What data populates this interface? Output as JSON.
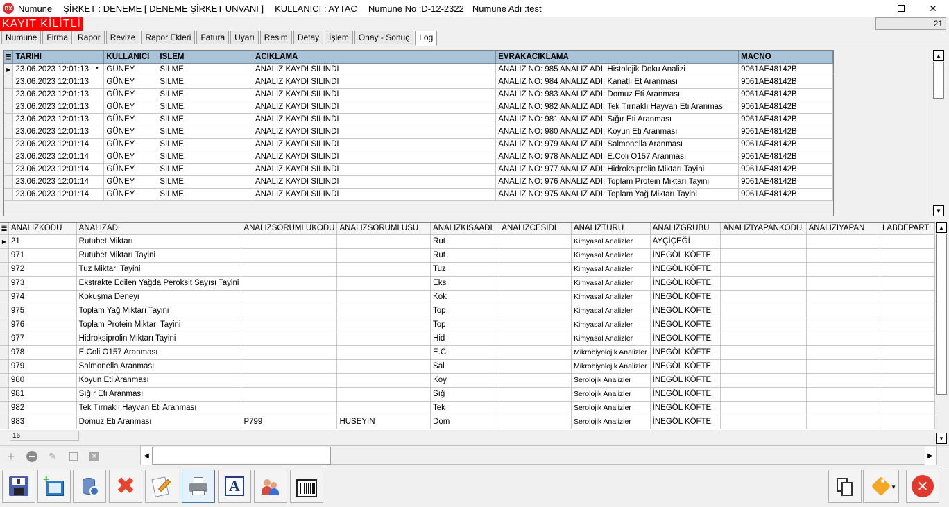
{
  "titlebar": {
    "icon_label": "DX",
    "app_name": "Numune",
    "company": "ŞİRKET : DENEME [ DENEME ŞİRKET UNVANI ]",
    "user": "KULLANICI : AYTAC",
    "sample_no": "Numune No :D-12-2322",
    "sample_name": "Numune Adı :test"
  },
  "lock_banner": "KAYIT KİLİTLİ",
  "record_count": "21",
  "tabs": [
    "Numune",
    "Firma",
    "Rapor",
    "Revize",
    "Rapor Ekleri",
    "Fatura",
    "Uyarı",
    "Resim",
    "Detay",
    "İşlem",
    "Onay - Sonuç",
    "Log"
  ],
  "active_tab": "Log",
  "log_grid": {
    "columns": [
      "TARIHI",
      "KULLANICI",
      "ISLEM",
      "ACIKLAMA",
      "EVRAKACIKLAMA",
      "MACNO"
    ],
    "rows": [
      [
        "23.06.2023 12:01:13",
        "GÜNEY",
        "SILME",
        "ANALIZ KAYDI SILINDI",
        "ANALIZ NO: 985 ANALIZ ADI: Histolojik Doku Analizi",
        "9061AE48142B"
      ],
      [
        "23.06.2023 12:01:13",
        "GÜNEY",
        "SILME",
        "ANALIZ KAYDI SILINDI",
        "ANALIZ NO: 984 ANALIZ ADI: Kanatlı Et  Aranması",
        "9061AE48142B"
      ],
      [
        "23.06.2023 12:01:13",
        "GÜNEY",
        "SILME",
        "ANALIZ KAYDI SILINDI",
        "ANALIZ NO: 983 ANALIZ ADI: Domuz Eti Aranması",
        "9061AE48142B"
      ],
      [
        "23.06.2023 12:01:13",
        "GÜNEY",
        "SILME",
        "ANALIZ KAYDI SILINDI",
        "ANALIZ NO: 982 ANALIZ ADI: Tek Tırnaklı Hayvan Eti Aranması",
        "9061AE48142B"
      ],
      [
        "23.06.2023 12:01:13",
        "GÜNEY",
        "SILME",
        "ANALIZ KAYDI SILINDI",
        "ANALIZ NO: 981 ANALIZ ADI: Sığır Eti Aranması",
        "9061AE48142B"
      ],
      [
        "23.06.2023 12:01:13",
        "GÜNEY",
        "SILME",
        "ANALIZ KAYDI SILINDI",
        "ANALIZ NO: 980 ANALIZ ADI: Koyun Eti Aranması",
        "9061AE48142B"
      ],
      [
        "23.06.2023 12:01:14",
        "GÜNEY",
        "SILME",
        "ANALIZ KAYDI SILINDI",
        "ANALIZ NO: 979 ANALIZ ADI: Salmonella Aranması",
        "9061AE48142B"
      ],
      [
        "23.06.2023 12:01:14",
        "GÜNEY",
        "SILME",
        "ANALIZ KAYDI SILINDI",
        "ANALIZ NO: 978 ANALIZ ADI: E.Coli O157 Aranması",
        "9061AE48142B"
      ],
      [
        "23.06.2023 12:01:14",
        "GÜNEY",
        "SILME",
        "ANALIZ KAYDI SILINDI",
        "ANALIZ NO: 977 ANALIZ ADI: Hidroksiprolin Miktarı Tayini",
        "9061AE48142B"
      ],
      [
        "23.06.2023 12:01:14",
        "GÜNEY",
        "SILME",
        "ANALIZ KAYDI SILINDI",
        "ANALIZ NO: 976 ANALIZ ADI: Toplam Protein Miktarı Tayini",
        "9061AE48142B"
      ],
      [
        "23.06.2023 12:01:14",
        "GÜNEY",
        "SILME",
        "ANALIZ KAYDI SILINDI",
        "ANALIZ NO: 975 ANALIZ ADI: Toplam Yağ Miktarı Tayini",
        "9061AE48142B"
      ]
    ]
  },
  "analysis_grid": {
    "columns": [
      "ANALIZKODU",
      "ANALIZADI",
      "ANALIZSORUMLUKODU",
      "ANALIZSORUMLUSU",
      "ANALIZKISAADI",
      "ANALIZCESIDI",
      "ANALIZTURU",
      "ANALIZGRUBU",
      "ANALIZIYAPANKODU",
      "ANALIZIYAPAN",
      "LABDEPART"
    ],
    "rows": [
      [
        "21",
        "Rutubet Miktarı",
        "",
        "",
        "Rut",
        "",
        "Kimyasal Analizler",
        "AYÇİÇEĞİ",
        "",
        "",
        ""
      ],
      [
        "971",
        "Rutubet Miktarı Tayini",
        "",
        "",
        "Rut",
        "",
        "Kimyasal Analizler",
        "İNEGÖL KÖFTE",
        "",
        "",
        ""
      ],
      [
        "972",
        "Tuz Miktarı Tayini",
        "",
        "",
        "Tuz",
        "",
        "Kimyasal Analizler",
        "İNEGÖL KÖFTE",
        "",
        "",
        ""
      ],
      [
        "973",
        "Ekstrakte Edilen Yağda Peroksit Sayısı Tayini",
        "",
        "",
        "Eks",
        "",
        "Kimyasal Analizler",
        "İNEGÖL KÖFTE",
        "",
        "",
        ""
      ],
      [
        "974",
        "Kokuşma Deneyi",
        "",
        "",
        "Kok",
        "",
        "Kimyasal Analizler",
        "İNEGÖL KÖFTE",
        "",
        "",
        ""
      ],
      [
        "975",
        "Toplam Yağ Miktarı Tayini",
        "",
        "",
        "Top",
        "",
        "Kimyasal Analizler",
        "İNEGÖL KÖFTE",
        "",
        "",
        ""
      ],
      [
        "976",
        "Toplam Protein Miktarı Tayini",
        "",
        "",
        "Top",
        "",
        "Kimyasal Analizler",
        "İNEGÖL KÖFTE",
        "",
        "",
        ""
      ],
      [
        "977",
        "Hidroksiprolin Miktarı Tayini",
        "",
        "",
        "Hid",
        "",
        "Kimyasal Analizler",
        "İNEGÖL KÖFTE",
        "",
        "",
        ""
      ],
      [
        "978",
        "E.Coli O157 Aranması",
        "",
        "",
        "E.C",
        "",
        "Mikrobiyolojik Analizler",
        "İNEGÖL KÖFTE",
        "",
        "",
        ""
      ],
      [
        "979",
        "Salmonella Aranması",
        "",
        "",
        "Sal",
        "",
        "Mikrobiyolojik Analizler",
        "İNEGÖL KÖFTE",
        "",
        "",
        ""
      ],
      [
        "980",
        "Koyun Eti Aranması",
        "",
        "",
        "Koy",
        "",
        "Serolojik Analizler",
        "İNEGÖL KÖFTE",
        "",
        "",
        ""
      ],
      [
        "981",
        "Sığır Eti Aranması",
        "",
        "",
        "Sığ",
        "",
        "Serolojik Analizler",
        "İNEGÖL KÖFTE",
        "",
        "",
        ""
      ],
      [
        "982",
        "Tek Tırnaklı Hayvan Eti Aranması",
        "",
        "",
        "Tek",
        "",
        "Serolojik Analizler",
        "İNEGÖL KÖFTE",
        "",
        "",
        ""
      ],
      [
        "983",
        "Domuz Eti Aranması",
        "P799",
        "HUSEYIN",
        "Dom",
        "",
        "Serolojik Analizler",
        "İNEGÖL KÖFTE",
        "",
        "",
        ""
      ]
    ],
    "footer_count": "16"
  },
  "toolbar_icon_text": "A",
  "colors": {
    "lock_banner_bg": "#ff0000",
    "grid_header_bg": "#a9c4d8",
    "close_red": "#e03a2f"
  }
}
